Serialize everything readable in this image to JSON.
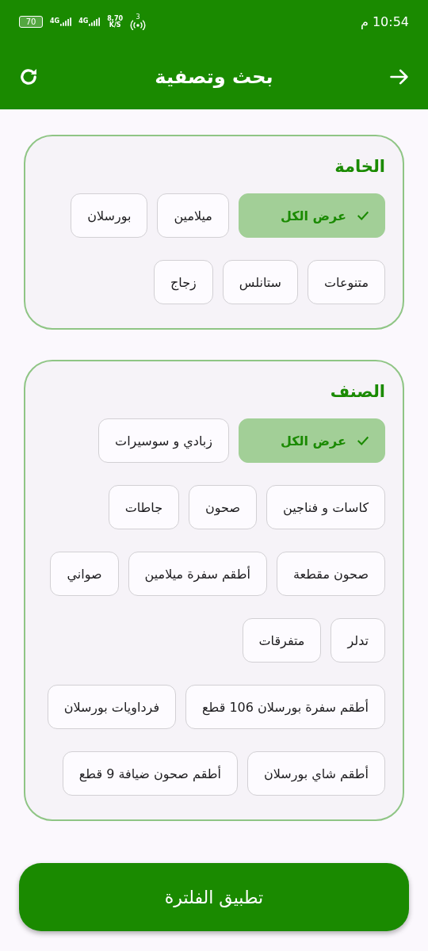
{
  "status_bar": {
    "time": "10:54 م",
    "hotspot": "3",
    "speed": "8,70",
    "speed_unit": "K/S",
    "networks": [
      "4G",
      "4G"
    ],
    "battery": "70"
  },
  "app_bar": {
    "title": "بحث وتصفية"
  },
  "sections": [
    {
      "title": "الخامة",
      "chips": [
        {
          "label": "عرض الكل",
          "selected": true
        },
        {
          "label": "ميلامين",
          "selected": false
        },
        {
          "label": "بورسلان",
          "selected": false
        },
        {
          "label": "متنوعات",
          "selected": false
        },
        {
          "label": "ستانلس",
          "selected": false
        },
        {
          "label": "زجاج",
          "selected": false
        }
      ]
    },
    {
      "title": "الصنف",
      "chips": [
        {
          "label": "عرض الكل",
          "selected": true
        },
        {
          "label": "زبادي و سوسيرات",
          "selected": false
        },
        {
          "label": "كاسات و فناجين",
          "selected": false
        },
        {
          "label": "صحون",
          "selected": false
        },
        {
          "label": "جاطات",
          "selected": false
        },
        {
          "label": "صحون مقطعة",
          "selected": false
        },
        {
          "label": "أطقم سفرة ميلامين",
          "selected": false
        },
        {
          "label": "صواني",
          "selected": false
        },
        {
          "label": "تدلر",
          "selected": false
        },
        {
          "label": "متفرقات",
          "selected": false
        },
        {
          "label": "أطقم سفرة بورسلان 106 قطع",
          "selected": false
        },
        {
          "label": "فرداويات بورسلان",
          "selected": false
        },
        {
          "label": "أطقم شاي بورسلان",
          "selected": false
        },
        {
          "label": "أطقم صحون ضيافة 9 قطع",
          "selected": false
        }
      ]
    }
  ],
  "apply_button": "تطبيق الفلترة"
}
